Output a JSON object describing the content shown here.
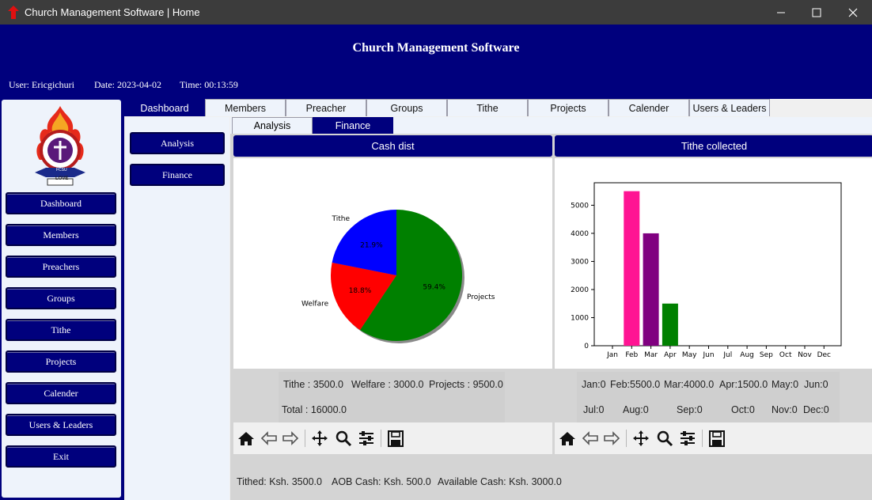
{
  "window": {
    "title": "Church Management Software | Home"
  },
  "header": {
    "app_title": "Church Management Software",
    "user": "User: Ericgichuri",
    "date": "Date: 2023-04-02",
    "time": "Time: 00:13:59"
  },
  "sidebar": {
    "items": [
      "Dashboard",
      "Members",
      "Preachers",
      "Groups",
      "Tithe",
      "Projects",
      "Calender",
      "Users & Leaders",
      "Exit"
    ],
    "logo_text": [
      "FCSU",
      "LOVE"
    ]
  },
  "top_tabs": [
    "Dashboard",
    "Members",
    "Preacher",
    "Groups",
    "Tithe",
    "Projects",
    "Calender",
    "Users & Leaders"
  ],
  "sub_nav": [
    "Analysis",
    "Finance"
  ],
  "sub_tabs": [
    "Analysis",
    "Finance"
  ],
  "panels": {
    "left_title": "Cash dist",
    "right_title": "Tithe collected"
  },
  "cash_stats": {
    "tithe": "Tithe  : 3500.0",
    "welfare": "Welfare : 3000.0",
    "projects": "Projects : 9500.0",
    "total": "Total : 16000.0"
  },
  "month_stats": [
    "Jan:0",
    "Feb:5500.0",
    "Mar:4000.0",
    "Apr:1500.0",
    "May:0",
    "Jun:0",
    "Jul:0",
    "Aug:0",
    "Sep:0",
    "Oct:0",
    "Nov:0",
    "Dec:0"
  ],
  "footer": {
    "tithed": "Tithed: Ksh. 3500.0",
    "aob": "AOB Cash: Ksh. 500.0",
    "available": "Available Cash: Ksh. 3000.0"
  },
  "toolbar_icons": [
    "home-icon",
    "back-arrow-icon",
    "forward-arrow-icon",
    "pan-icon",
    "zoom-icon",
    "configure-icon",
    "save-icon"
  ],
  "chart_data": [
    {
      "type": "pie",
      "labels": [
        "Projects",
        "Welfare",
        "Tithe"
      ],
      "values": [
        59.4,
        18.8,
        21.9
      ],
      "percent_labels": [
        "59.4%",
        "18.8%",
        "21.9%"
      ],
      "colors": [
        "#008000",
        "#ff0000",
        "#0000ff"
      ]
    },
    {
      "type": "bar",
      "categories": [
        "Jan",
        "Feb",
        "Mar",
        "Apr",
        "May",
        "Jun",
        "Jul",
        "Aug",
        "Sep",
        "Oct",
        "Nov",
        "Dec"
      ],
      "values": [
        0,
        5500,
        4000,
        1500,
        0,
        0,
        0,
        0,
        0,
        0,
        0,
        0
      ],
      "colors": [
        "#ff1493",
        "#800080",
        "#008000"
      ],
      "yticks": [
        0,
        1000,
        2000,
        3000,
        4000,
        5000
      ],
      "ylim": [
        0,
        5800
      ]
    }
  ]
}
